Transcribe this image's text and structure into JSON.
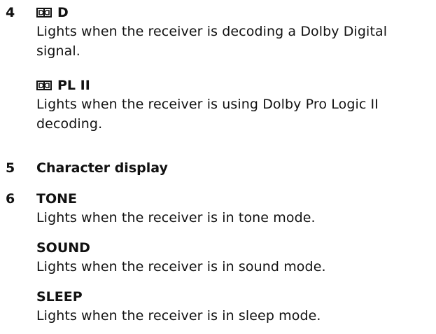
{
  "items": [
    {
      "number": "4",
      "entries": [
        {
          "logo": "dolby-double-d-icon",
          "heading": "D",
          "description": "Lights when the receiver is decoding a Dolby Digital signal."
        },
        {
          "logo": "dolby-double-d-icon",
          "heading": "PL II",
          "description": "Lights when the receiver is using Dolby Pro Logic II decoding."
        }
      ]
    },
    {
      "number": "5",
      "heading": "Character display"
    },
    {
      "number": "6",
      "entries": [
        {
          "heading": "TONE",
          "description": "Lights when the receiver is in tone mode."
        },
        {
          "heading": "SOUND",
          "description": "Lights when the receiver is in sound mode."
        },
        {
          "heading": "SLEEP",
          "description": "Lights when the receiver is in sleep mode."
        }
      ]
    }
  ]
}
